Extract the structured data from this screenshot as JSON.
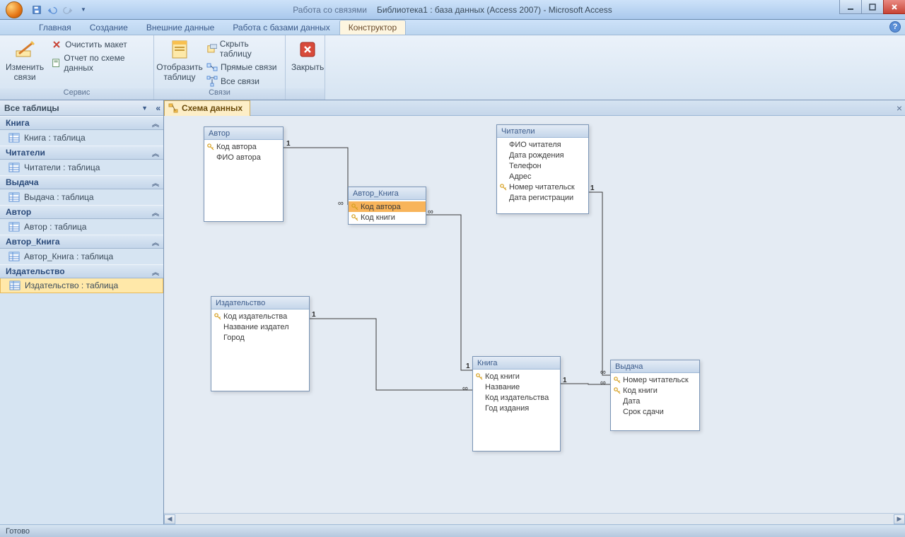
{
  "titlebar": {
    "contextual": "Работа со связями",
    "doc": "Библиотека1 : база данных (Access 2007) - Microsoft Access"
  },
  "ribbon_tabs": [
    "Главная",
    "Создание",
    "Внешние данные",
    "Работа с базами данных",
    "Конструктор"
  ],
  "active_tab": "Конструктор",
  "ribbon": {
    "group1": {
      "label": "Сервис",
      "edit_btn": "Изменить\nсвязи",
      "clear": "Очистить макет",
      "report": "Отчет по схеме данных"
    },
    "group2": {
      "label": "Связи",
      "show_table": "Отобразить\nтаблицу",
      "hide_table": "Скрыть таблицу",
      "direct": "Прямые связи",
      "all_rel": "Все связи"
    },
    "group3": {
      "close": "Закрыть"
    }
  },
  "navpane": {
    "header": "Все таблицы",
    "groups": [
      {
        "name": "Книга",
        "items": [
          "Книга : таблица"
        ]
      },
      {
        "name": "Читатели",
        "items": [
          "Читатели : таблица"
        ]
      },
      {
        "name": "Выдача",
        "items": [
          "Выдача : таблица"
        ]
      },
      {
        "name": "Автор",
        "items": [
          "Автор : таблица"
        ]
      },
      {
        "name": "Автор_Книга",
        "items": [
          "Автор_Книга : таблица"
        ]
      },
      {
        "name": "Издательство",
        "items": [
          "Издательство : таблица"
        ],
        "selected": true
      }
    ]
  },
  "document_tab": "Схема данных",
  "tables": {
    "avtor": {
      "title": "Автор",
      "fields": [
        {
          "k": true,
          "n": "Код автора"
        },
        {
          "k": false,
          "n": "ФИО автора"
        }
      ]
    },
    "avtor_kniga": {
      "title": "Автор_Книга",
      "fields": [
        {
          "k": true,
          "n": "Код автора",
          "sel": true
        },
        {
          "k": true,
          "n": "Код книги"
        }
      ]
    },
    "chitateli": {
      "title": "Читатели",
      "fields": [
        {
          "k": false,
          "n": "ФИО читателя"
        },
        {
          "k": false,
          "n": "Дата рождения"
        },
        {
          "k": false,
          "n": "Телефон"
        },
        {
          "k": false,
          "n": "Адрес"
        },
        {
          "k": true,
          "n": "Номер  читательск"
        },
        {
          "k": false,
          "n": "Дата регистрации"
        }
      ]
    },
    "izdatelstvo": {
      "title": "Издательство",
      "fields": [
        {
          "k": true,
          "n": "Код издательства"
        },
        {
          "k": false,
          "n": "Название издател"
        },
        {
          "k": false,
          "n": "Город"
        }
      ]
    },
    "kniga": {
      "title": "Книга",
      "fields": [
        {
          "k": true,
          "n": "Код книги"
        },
        {
          "k": false,
          "n": "Название"
        },
        {
          "k": false,
          "n": "Код издательства"
        },
        {
          "k": false,
          "n": "Год издания"
        }
      ]
    },
    "vydacha": {
      "title": "Выдача",
      "fields": [
        {
          "k": true,
          "n": "Номер читательск"
        },
        {
          "k": true,
          "n": "Код книги"
        },
        {
          "k": false,
          "n": "Дата"
        },
        {
          "k": false,
          "n": "Срок сдачи"
        }
      ]
    }
  },
  "status": "Готово"
}
